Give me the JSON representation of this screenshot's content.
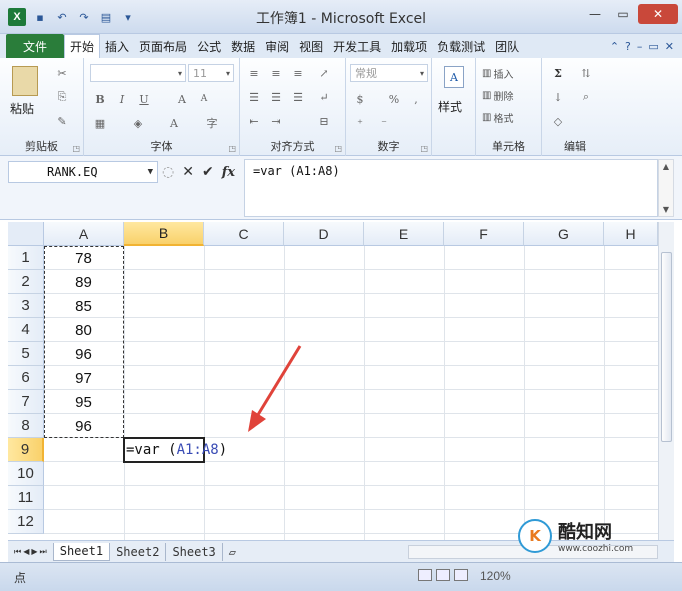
{
  "window": {
    "title": "工作簿1 - Microsoft Excel",
    "app_icon_letter": "X",
    "minimize": "—",
    "restore": "▭",
    "close": "✕"
  },
  "ribbon_tabs": [
    "文件",
    "开始",
    "插入",
    "页面布局",
    "公式",
    "数据",
    "审阅",
    "视图",
    "开发工具",
    "加载项",
    "负载测试",
    "团队"
  ],
  "ribbon": {
    "clipboard": {
      "label": "剪贴板",
      "paste": "粘贴"
    },
    "font": {
      "label": "字体",
      "size": "11",
      "bold": "B",
      "italic": "I",
      "underline": "U"
    },
    "alignment": {
      "label": "对齐方式"
    },
    "number": {
      "label": "数字",
      "format": "常规",
      "percent": "%"
    },
    "styles": {
      "label": "样式"
    },
    "cells": {
      "label": "单元格",
      "insert": "插入",
      "delete": "删除",
      "format": "格式"
    },
    "editing": {
      "label": "编辑",
      "sum": "Σ"
    }
  },
  "formula_bar": {
    "name_box": "RANK.EQ",
    "cancel": "✕",
    "confirm": "✔",
    "fx": "fx",
    "formula": "=var (A1:A8)"
  },
  "columns": [
    "A",
    "B",
    "C",
    "D",
    "E",
    "F",
    "G",
    "H"
  ],
  "rows": [
    "1",
    "2",
    "3",
    "4",
    "5",
    "6",
    "7",
    "8",
    "9",
    "10",
    "11",
    "12"
  ],
  "column_a_values": [
    "78",
    "89",
    "85",
    "80",
    "96",
    "97",
    "95",
    "96"
  ],
  "active_cell": {
    "address": "B9",
    "prefix": "=var (",
    "ref": "A1:A8",
    "suffix": ")"
  },
  "sheets": [
    "Sheet1",
    "Sheet2",
    "Sheet3"
  ],
  "status": {
    "mode": "点",
    "zoom": "120%"
  },
  "watermark": {
    "name": "酷知网",
    "url": "www.coozhi.com",
    "logo_text": "K"
  },
  "colors": {
    "file_tab": "#2a7d3a",
    "selected_header": "#f9d16b",
    "arrow": "#e0433a",
    "ref_blue": "#3a4cb5"
  }
}
